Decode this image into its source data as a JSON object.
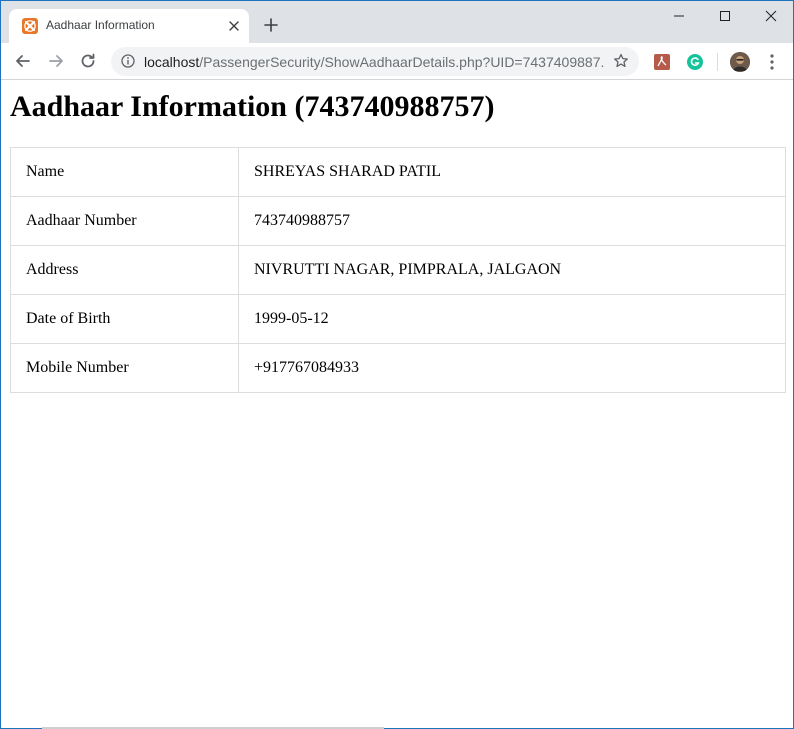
{
  "browser": {
    "tab_title": "Aadhaar Information",
    "url_host": "localhost",
    "url_path": "/PassengerSecurity/ShowAadhaarDetails.php?UID=7437409887..."
  },
  "page": {
    "title": "Aadhaar Information (743740988757)",
    "rows": [
      {
        "label": "Name",
        "value": "SHREYAS SHARAD PATIL"
      },
      {
        "label": "Aadhaar Number",
        "value": "743740988757"
      },
      {
        "label": "Address",
        "value": "NIVRUTTI NAGAR, PIMPRALA, JALGAON"
      },
      {
        "label": "Date of Birth",
        "value": "1999-05-12"
      },
      {
        "label": "Mobile Number",
        "value": "+917767084933"
      }
    ]
  },
  "colors": {
    "tabstrip": "#dee1e6",
    "omnibox": "#f1f3f4",
    "favicon": "#e8772a",
    "window_border": "#1e73be",
    "table_border": "#dddddd"
  },
  "icons": {
    "favicon": "xampp-icon",
    "close": "close-icon",
    "new_tab": "plus-icon",
    "back": "arrow-left-icon",
    "forward": "arrow-right-icon",
    "reload": "reload-icon",
    "info": "info-icon",
    "star": "star-icon",
    "pdf_ext": "pdf-extension-icon",
    "grammarly_ext": "grammarly-icon",
    "menu": "kebab-menu-icon"
  }
}
